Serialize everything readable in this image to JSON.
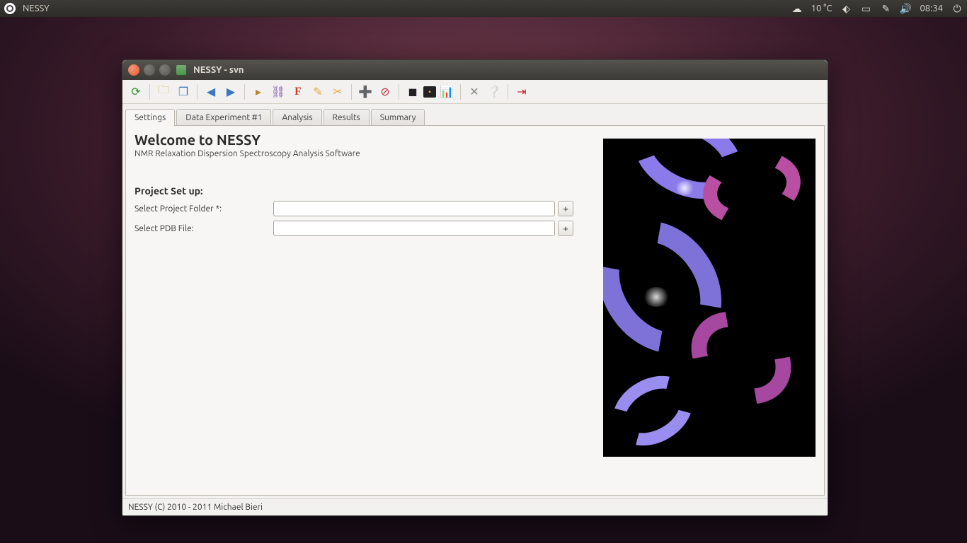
{
  "panel": {
    "app_name": "NESSY",
    "weather": "10 °C",
    "clock": "08:34"
  },
  "window": {
    "title": "NESSY - svn"
  },
  "tabs": [
    {
      "label": "Settings"
    },
    {
      "label": "Data Experiment #1"
    },
    {
      "label": "Analysis"
    },
    {
      "label": "Results"
    },
    {
      "label": "Summary"
    }
  ],
  "settings": {
    "welcome_title": "Welcome to NESSY",
    "welcome_subtitle": "NMR Relaxation Dispersion Spectroscopy Analysis Software",
    "section_head": "Project Set up:",
    "project_folder_label": "Select Project Folder *:",
    "project_folder_value": "",
    "pdb_file_label": "Select PDB File:",
    "pdb_file_value": "",
    "browse_label": "+"
  },
  "status": {
    "text": "NESSY (C) 2010 - 2011 Michael Bieri"
  }
}
